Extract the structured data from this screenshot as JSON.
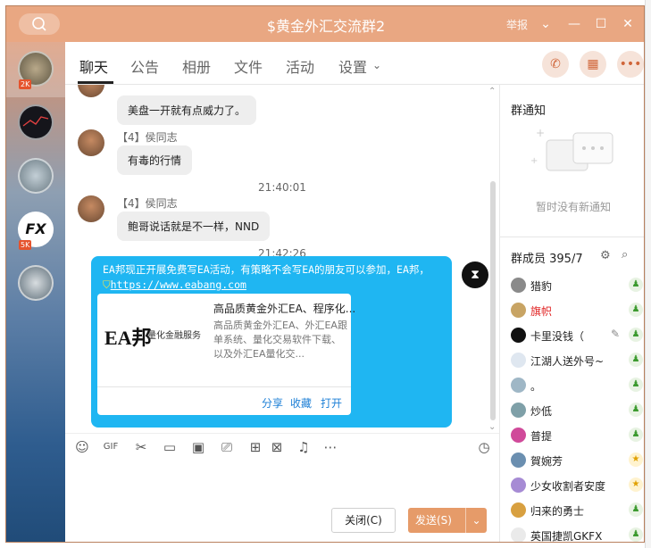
{
  "window": {
    "title": "$黄金外汇交流群2",
    "report_label": "举报"
  },
  "sidebar": {
    "items": [
      {
        "badge": "2K",
        "color": "#8b7a5f"
      },
      {
        "badge": "",
        "color": "#1c1c22"
      },
      {
        "badge": "",
        "color": "#8a9aa4"
      },
      {
        "badge": "5K",
        "color": "#ffffff",
        "text": "FX"
      },
      {
        "badge": "",
        "color": "#7c8c96"
      }
    ]
  },
  "tabs": [
    {
      "label": "聊天",
      "active": true
    },
    {
      "label": "公告"
    },
    {
      "label": "相册"
    },
    {
      "label": "文件"
    },
    {
      "label": "活动"
    },
    {
      "label": "设置"
    }
  ],
  "chat": {
    "messages": [
      {
        "text": "美盘一开就有点威力了。"
      },
      {
        "name": "【4】侯同志",
        "text": "有毒的行情"
      },
      {
        "timestamp": "21:40:01"
      },
      {
        "name": "【4】侯同志",
        "text": "鲍哥说话就是不一样，NND"
      },
      {
        "timestamp": "21:42:26"
      }
    ],
    "big_message": {
      "text": "EA邦现正开展免费写EA活动，有策略不会写EA的朋友可以参加，EA邦，",
      "link": "https://www.eabang.com",
      "card": {
        "logo_text": "EA邦",
        "logo_sub": "量化金融服务",
        "title": "高品质黄金外汇EA、程序化...",
        "desc": "高品质黄金外汇EA、外汇EA跟单系统、量化交易软件下载、以及外汇EA量化交...",
        "actions": [
          "分享",
          "收藏",
          "打开"
        ]
      }
    }
  },
  "composer": {
    "close_label": "关闭(C)",
    "send_label": "发送(S)"
  },
  "right_panel": {
    "notice_title": "群通知",
    "notice_empty": "暂时没有新通知",
    "members_title": "群成员 395/7",
    "members": [
      {
        "name": "猎豹",
        "color": "#222"
      },
      {
        "name": "旗帜",
        "color": "#e02020"
      },
      {
        "name": "卡里没钱（",
        "color": "#222"
      },
      {
        "name": "江湖人送外号~",
        "color": "#222"
      },
      {
        "name": "。",
        "color": "#222"
      },
      {
        "name": "炒低",
        "color": "#222"
      },
      {
        "name": "普提",
        "color": "#222"
      },
      {
        "name": "賀婉芳",
        "color": "#222"
      },
      {
        "name": "少女收割者安度",
        "color": "#222"
      },
      {
        "name": "归来的勇士",
        "color": "#222"
      },
      {
        "name": "英国捷凯GKFX",
        "color": "#222"
      }
    ]
  }
}
